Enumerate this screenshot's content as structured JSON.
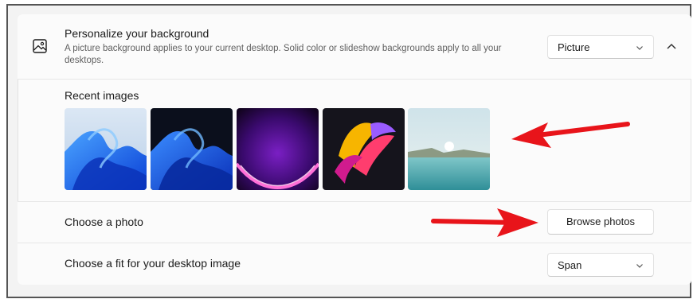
{
  "section": {
    "title": "Personalize your background",
    "description": "A picture background applies to your current desktop. Solid color or slideshow backgrounds apply to all your desktops.",
    "background_type": {
      "selected": "Picture"
    },
    "collapse_icon": "chevron-up-icon",
    "section_icon": "picture-icon"
  },
  "recent_images": {
    "label": "Recent images",
    "items": [
      {
        "name": "blue-bloom-light"
      },
      {
        "name": "blue-bloom-dark"
      },
      {
        "name": "purple-glow"
      },
      {
        "name": "pink-ribbon"
      },
      {
        "name": "lake-sunrise"
      }
    ]
  },
  "choose_photo": {
    "label": "Choose a photo",
    "button_label": "Browse photos"
  },
  "choose_fit": {
    "label": "Choose a fit for your desktop image",
    "selected": "Span"
  },
  "annotation": {
    "arrow_color": "#e8141a"
  }
}
